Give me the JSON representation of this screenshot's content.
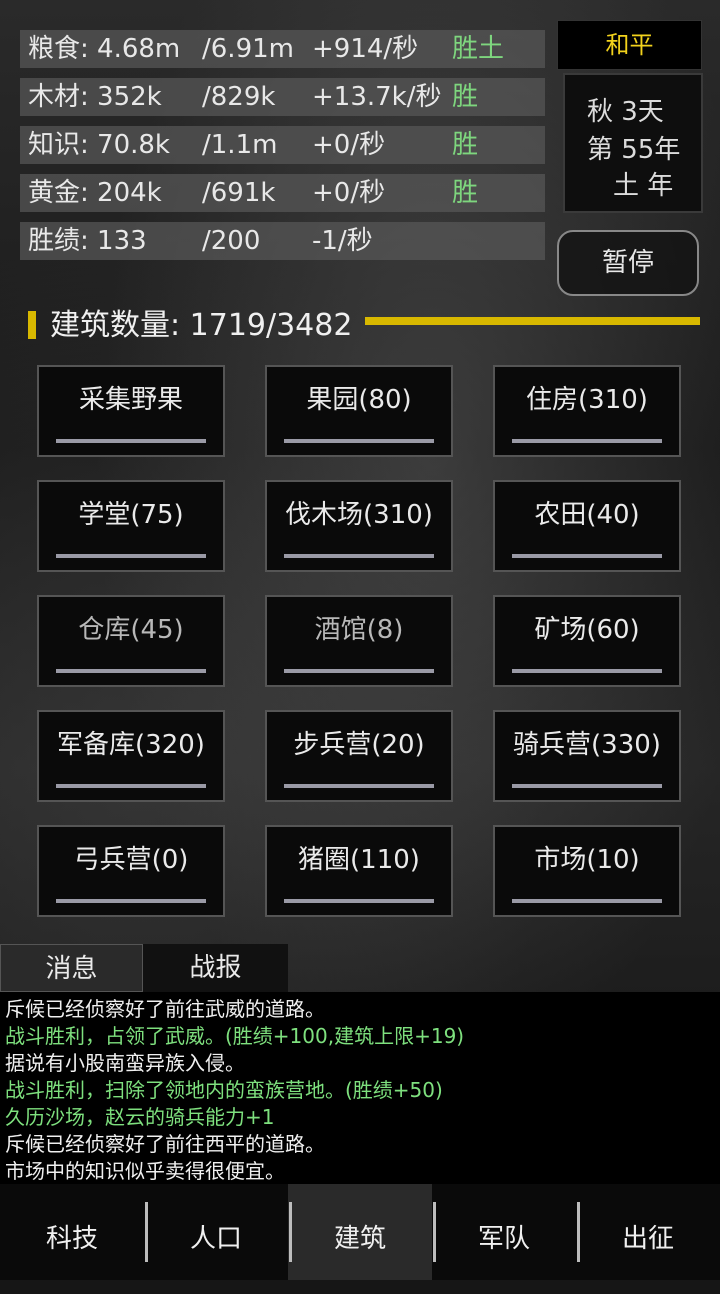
{
  "resources": [
    {
      "name": "粮食: 4.68m",
      "max": "/6.91m",
      "rate": "+914/秒",
      "flag": "胜土"
    },
    {
      "name": "木材: 352k",
      "max": "/829k",
      "rate": "+13.7k/秒",
      "flag": "胜"
    },
    {
      "name": "知识: 70.8k",
      "max": "/1.1m",
      "rate": "+0/秒",
      "flag": "胜"
    },
    {
      "name": "黄金: 204k",
      "max": "/691k",
      "rate": "+0/秒",
      "flag": "胜"
    },
    {
      "name": "胜绩: 133",
      "max": "/200",
      "rate": "-1/秒",
      "flag": ""
    }
  ],
  "status": {
    "peace": "和平",
    "date_line1": "秋 3天",
    "date_line2": "第 55年",
    "date_line3": "土 年",
    "pause_label": "暂停"
  },
  "building_count": {
    "label": "建筑数量: 1719/3482",
    "progress": 0.494
  },
  "buildings": [
    {
      "label": "采集野果"
    },
    {
      "label": "果园(80)"
    },
    {
      "label": "住房(310)"
    },
    {
      "label": "学堂(75)"
    },
    {
      "label": "伐木场(310)"
    },
    {
      "label": "农田(40)"
    },
    {
      "label": "仓库(45)"
    },
    {
      "label": "酒馆(8)"
    },
    {
      "label": "矿场(60)"
    },
    {
      "label": "军备库(320)"
    },
    {
      "label": "步兵营(20)"
    },
    {
      "label": "骑兵营(330)"
    },
    {
      "label": "弓兵营(0)"
    },
    {
      "label": "猪圈(110)"
    },
    {
      "label": "市场(10)"
    }
  ],
  "tabs": {
    "messages": "消息",
    "battle_report": "战报"
  },
  "log": [
    {
      "text": "斥候已经侦察好了前往武威的道路。",
      "color": "#f0f0f0"
    },
    {
      "text": "战斗胜利，占领了武威。(胜绩+100,建筑上限+19)",
      "color": "#7ee07e"
    },
    {
      "text": "据说有小股南蛮异族入侵。",
      "color": "#f0f0f0"
    },
    {
      "text": "战斗胜利，扫除了领地内的蛮族营地。(胜绩+50)",
      "color": "#7ee07e"
    },
    {
      "text": "久历沙场，赵云的骑兵能力+1",
      "color": "#7ee07e"
    },
    {
      "text": "斥候已经侦察好了前往西平的道路。",
      "color": "#f0f0f0"
    },
    {
      "text": "市场中的知识似乎卖得很便宜。",
      "color": "#f0f0f0"
    }
  ],
  "nav": [
    {
      "label": "科技",
      "active": false
    },
    {
      "label": "人口",
      "active": false
    },
    {
      "label": "建筑",
      "active": true
    },
    {
      "label": "军队",
      "active": false
    },
    {
      "label": "出征",
      "active": false
    }
  ],
  "colors": {
    "accent": "#d8b800",
    "positive": "#7ee07e",
    "peace": "#f2d21c"
  }
}
